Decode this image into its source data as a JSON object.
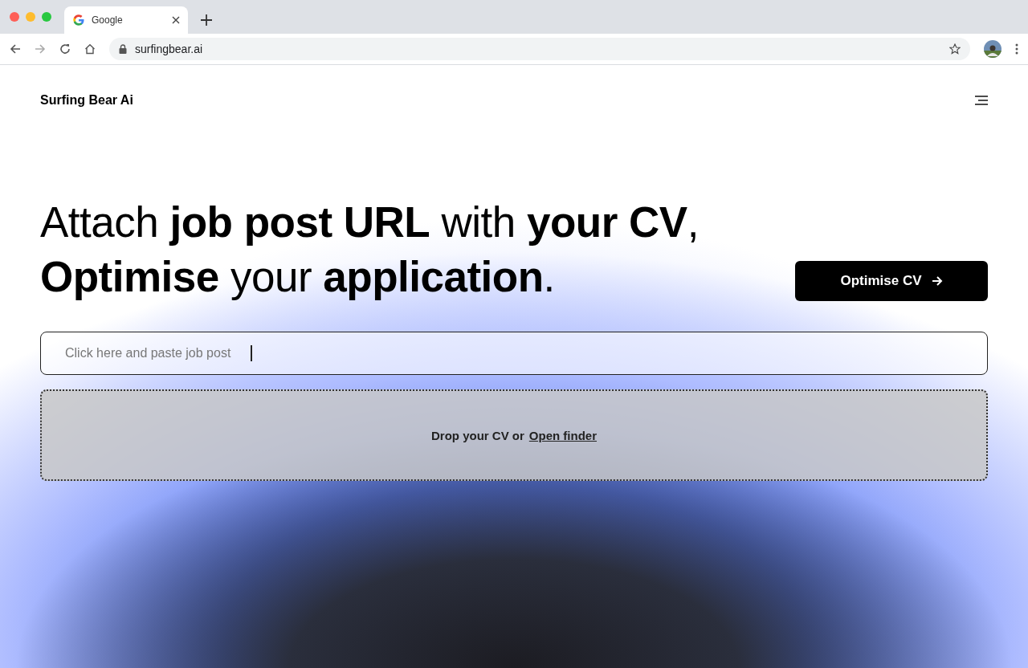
{
  "browser": {
    "tabs": [
      {
        "title": "Google",
        "selected": true
      }
    ],
    "url": "surfingbear.ai"
  },
  "header": {
    "logo": "Surfing Bear Ai"
  },
  "hero": {
    "headline": [
      "Attach **job post URL** with **your CV**,",
      "**Optimise** your **application**."
    ],
    "button": "Optimise CV"
  },
  "job_field": {
    "placeholder": "Click here and paste job post"
  },
  "dropzone": {
    "text": "Drop your CV or",
    "link": "Open finder"
  }
}
